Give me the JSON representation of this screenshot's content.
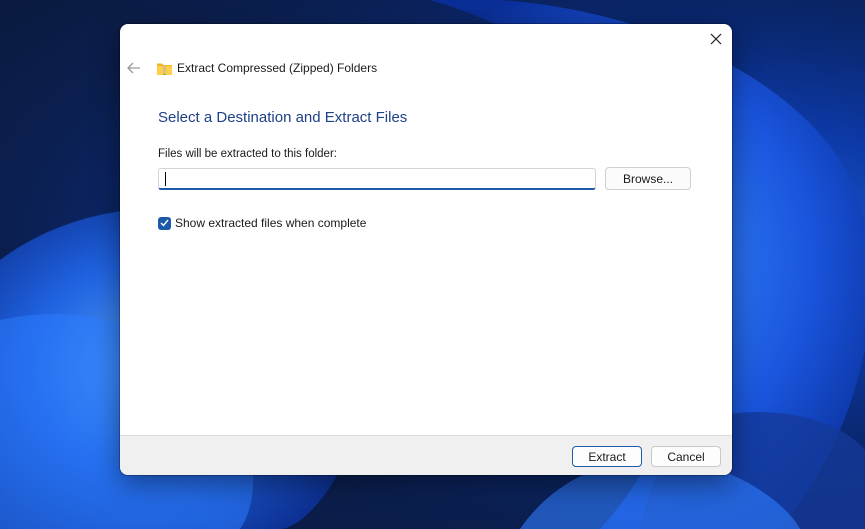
{
  "dialog": {
    "title": "Extract Compressed (Zipped) Folders",
    "heading": "Select a Destination and Extract Files",
    "field_label": "Files will be extracted to this folder:",
    "destination_value": "",
    "browse_label": "Browse...",
    "show_files_label": "Show extracted files when complete",
    "show_files_checked": true,
    "extract_label": "Extract",
    "cancel_label": "Cancel"
  },
  "icons": {
    "close": "close-icon",
    "back": "back-arrow-icon",
    "title": "zipped-folder-icon",
    "check": "checkmark-icon"
  },
  "colors": {
    "accent": "#1b5aa8",
    "heading": "#1f3f86",
    "footer_bg": "#f0f0f0",
    "wallpaper": "#0d3aa8"
  }
}
